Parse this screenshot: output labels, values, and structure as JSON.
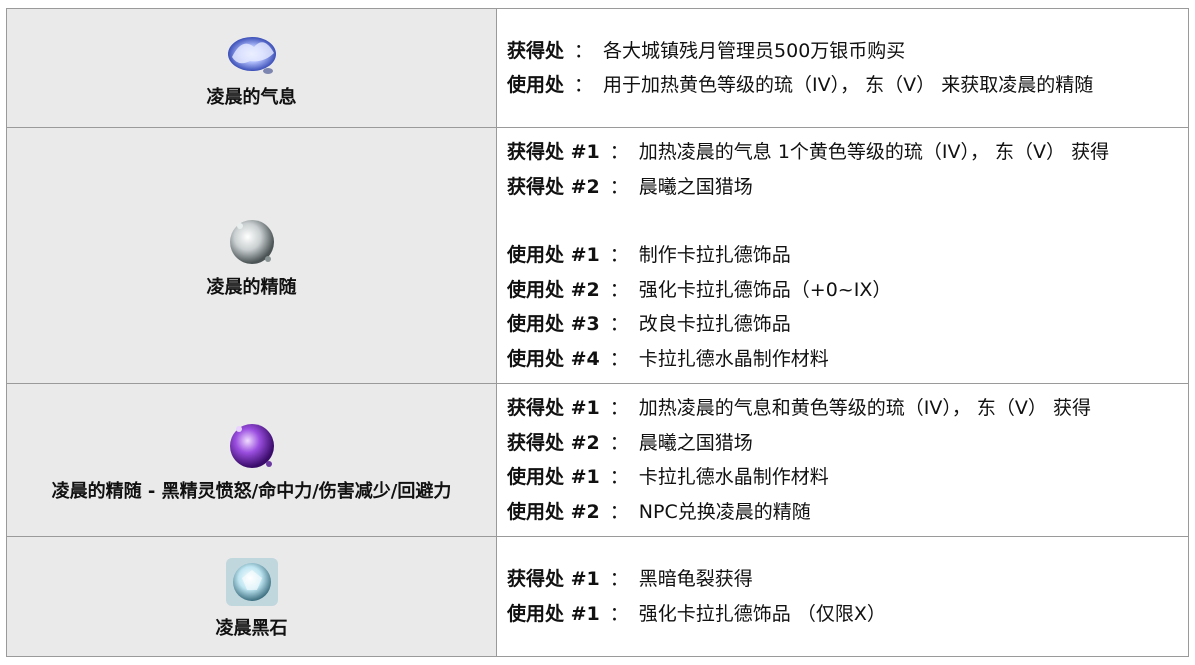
{
  "rows": [
    {
      "name": "凌晨的气息",
      "icon": "dawn-breath-icon",
      "lines": [
        {
          "label": "获得处",
          "text": "各大城镇残月管理员500万银币购买"
        },
        {
          "label": "使用处",
          "text": "用于加热黄色等级的琉（IV）， 东（V） 来获取凌晨的精随"
        }
      ]
    },
    {
      "name": "凌晨的精随",
      "icon": "dawn-essence-icon",
      "lines": [
        {
          "label": "获得处 #1",
          "text": "加热凌晨的气息 1个黄色等级的琉（IV）， 东（V） 获得"
        },
        {
          "label": "获得处 #2",
          "text": "晨曦之国猎场"
        },
        {
          "label": "使用处 #1",
          "text": "制作卡拉扎德饰品"
        },
        {
          "label": "使用处 #2",
          "text": "强化卡拉扎德饰品（+0~IX）"
        },
        {
          "label": "使用处 #3",
          "text": "改良卡拉扎德饰品"
        },
        {
          "label": "使用处 #4",
          "text": "卡拉扎德水晶制作材料"
        }
      ]
    },
    {
      "name": "凌晨的精随 - 黑精灵愤怒/命中力/伤害减少/回避力",
      "icon": "purple-essence-icon",
      "lines": [
        {
          "label": "获得处 #1",
          "text": "加热凌晨的气息和黄色等级的琉（IV）， 东（V） 获得"
        },
        {
          "label": "获得处 #2",
          "text": "晨曦之国猎场"
        },
        {
          "label": "使用处 #1",
          "text": "卡拉扎德水晶制作材料"
        },
        {
          "label": "使用处 #2",
          "text": "NPC兑换凌晨的精随"
        }
      ]
    },
    {
      "name": "凌晨黑石",
      "icon": "dawn-blackstone-icon",
      "lines": [
        {
          "label": "获得处 #1",
          "text": "黑暗龟裂获得"
        },
        {
          "label": "使用处 #1",
          "text": "强化卡拉扎德饰品 （仅限X）"
        }
      ]
    }
  ],
  "separator": "：",
  "colors": {
    "left_bg": "#eaeaea",
    "border": "#9a9a9a"
  }
}
